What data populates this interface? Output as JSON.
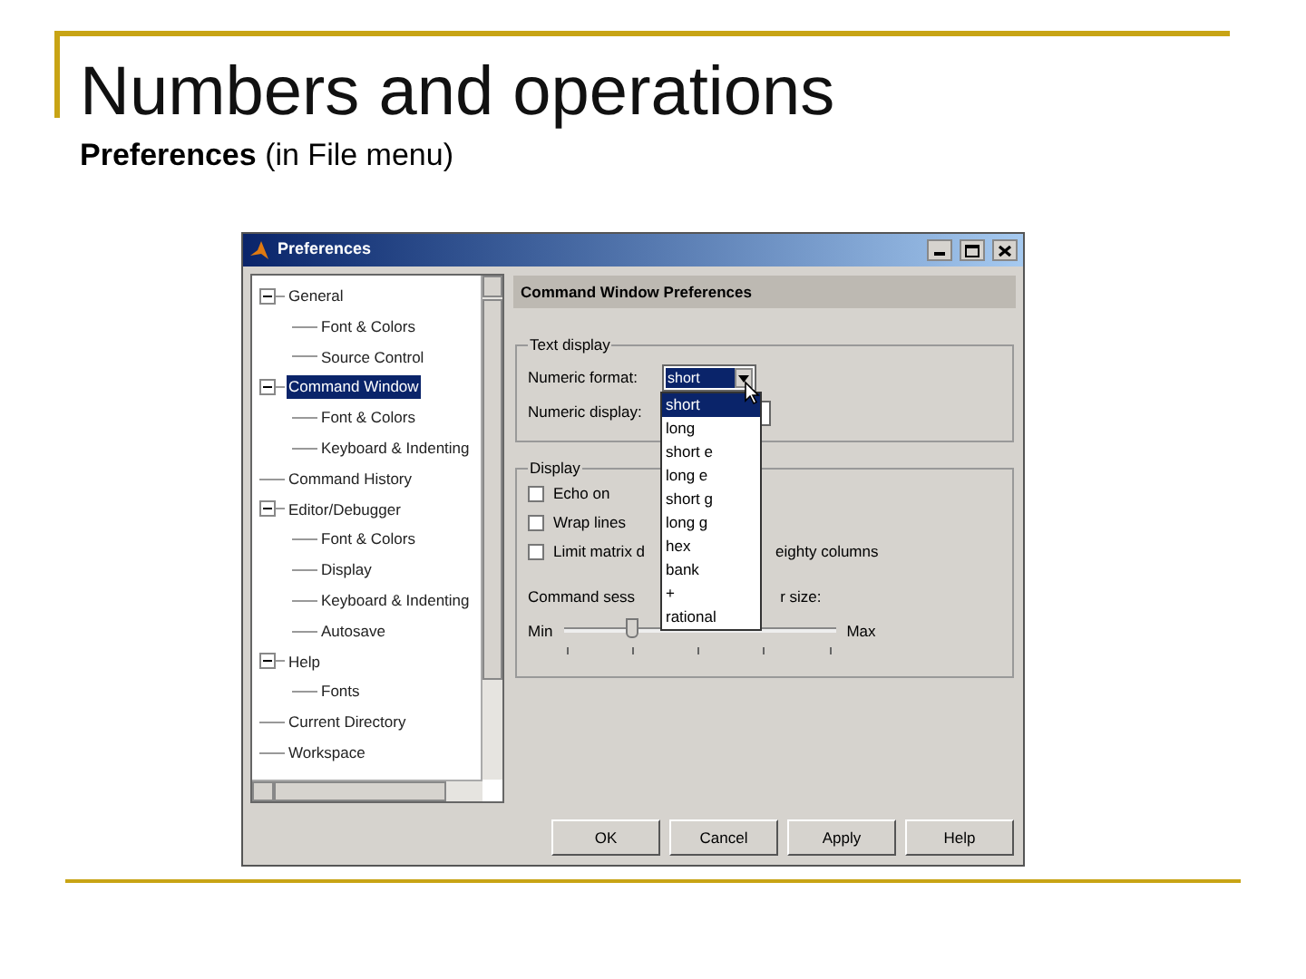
{
  "slide": {
    "title": "Numbers and operations",
    "subtitle": "**Preferences** (in File menu)"
  },
  "window": {
    "title": "Preferences"
  },
  "tree": [
    {
      "label": "General",
      "expanded": true,
      "selected": false,
      "children": [
        {
          "label": "Font & Colors",
          "selected": false
        },
        {
          "label": "Source Control",
          "selected": false
        }
      ]
    },
    {
      "label": "Command Window",
      "expanded": true,
      "selected": true,
      "children": [
        {
          "label": "Font & Colors",
          "selected": false
        },
        {
          "label": "Keyboard & Indenting",
          "selected": false
        }
      ]
    },
    {
      "label": "Command History",
      "selected": false
    },
    {
      "label": "Editor/Debugger",
      "expanded": true,
      "selected": false,
      "children": [
        {
          "label": "Font & Colors",
          "selected": false
        },
        {
          "label": "Display",
          "selected": false
        },
        {
          "label": "Keyboard & Indenting",
          "selected": false
        },
        {
          "label": "Autosave",
          "selected": false
        }
      ]
    },
    {
      "label": "Help",
      "expanded": true,
      "selected": false,
      "children": [
        {
          "label": "Fonts",
          "selected": false
        }
      ]
    },
    {
      "label": "Current Directory",
      "selected": false
    },
    {
      "label": "Workspace",
      "selected": false
    }
  ],
  "panel": {
    "header": "Command Window Preferences",
    "text_display": {
      "legend": "Text display",
      "numeric_format_label": "Numeric format:",
      "numeric_format_value": "short",
      "numeric_display_label": "Numeric display:",
      "options": [
        {
          "label": "short",
          "selected": true
        },
        {
          "label": "long",
          "selected": false
        },
        {
          "label": "short e",
          "selected": false
        },
        {
          "label": "long e",
          "selected": false
        },
        {
          "label": "short g",
          "selected": false
        },
        {
          "label": "long g",
          "selected": false
        },
        {
          "label": "hex",
          "selected": false
        },
        {
          "label": "bank",
          "selected": false
        },
        {
          "label": "+",
          "selected": false
        },
        {
          "label": "rational",
          "selected": false
        }
      ]
    },
    "display": {
      "legend": "Display",
      "checkboxes": [
        {
          "label": "Echo on",
          "checked": false
        },
        {
          "label": "Wrap lines",
          "checked": false
        },
        {
          "label": "Limit matrix d",
          "label_tail": "eighty columns",
          "checked": false
        }
      ],
      "buffer_label": "Command sess",
      "buffer_label_tail": "r size:",
      "slider": {
        "level": 0.24,
        "min_label": "Min",
        "max_label": "Max"
      }
    }
  },
  "buttons": [
    "OK",
    "Cancel",
    "Apply",
    "Help"
  ]
}
